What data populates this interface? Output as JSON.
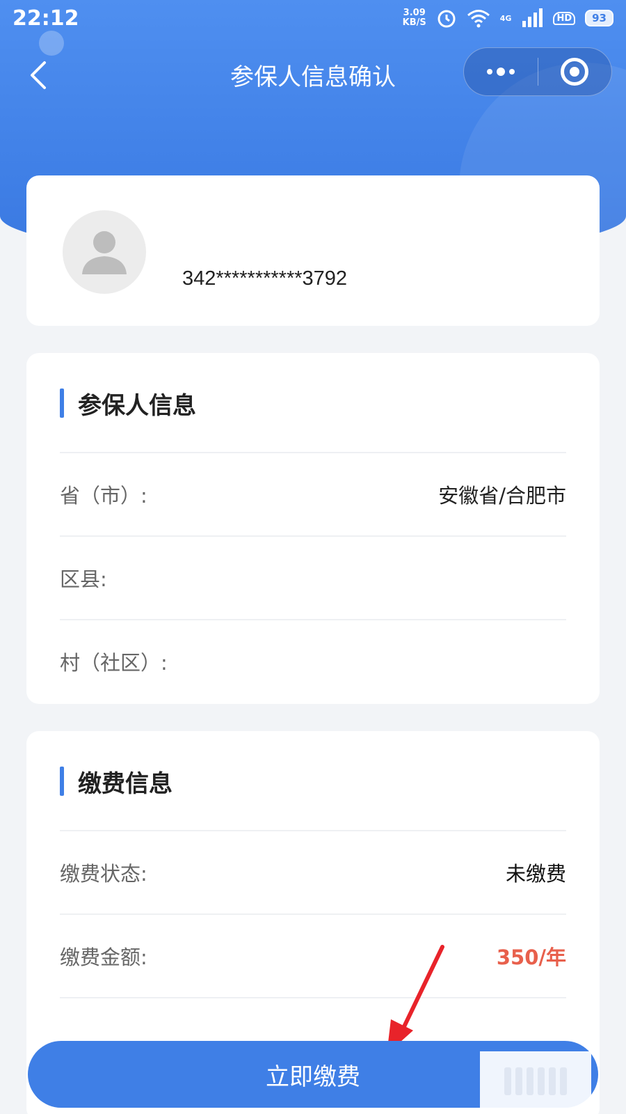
{
  "status_bar": {
    "time": "22:12",
    "speed_value": "3.09",
    "speed_unit": "KB/S",
    "network": "4G",
    "hd": "HD",
    "battery": "93"
  },
  "nav": {
    "title": "参保人信息确认"
  },
  "profile": {
    "id_number": "342***********3792"
  },
  "insured_info": {
    "title": "参保人信息",
    "rows": [
      {
        "label": "省（市）:",
        "value": "安徽省/合肥市"
      },
      {
        "label": "区县:",
        "value": ""
      },
      {
        "label": "村（社区）:",
        "value": ""
      }
    ]
  },
  "payment_info": {
    "title": "缴费信息",
    "rows": [
      {
        "label": "缴费状态:",
        "value": "未缴费"
      },
      {
        "label": "缴费金额:",
        "value": "350/年"
      }
    ]
  },
  "pay_button_label": "立即缴费",
  "colors": {
    "primary": "#3f7fe6",
    "warning": "#e8604c",
    "annotation_arrow": "#e8232a"
  }
}
